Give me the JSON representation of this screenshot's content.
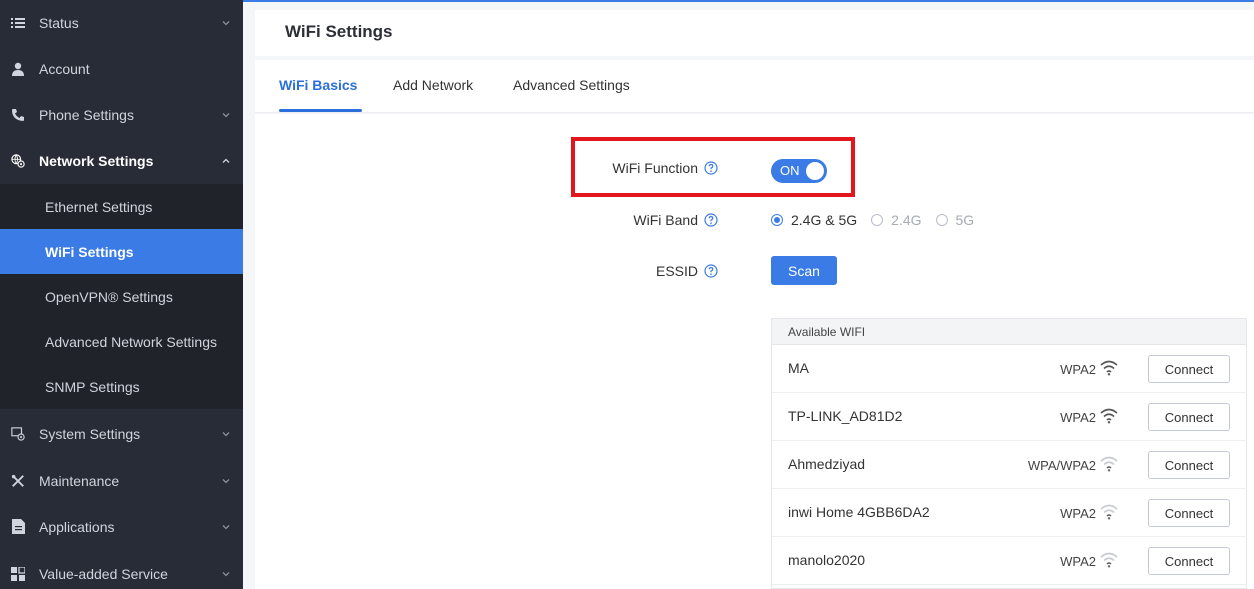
{
  "sidebar": {
    "items": [
      {
        "label": "Status",
        "icon": "list-icon"
      },
      {
        "label": "Account",
        "icon": "user-icon"
      },
      {
        "label": "Phone Settings",
        "icon": "phone-icon"
      },
      {
        "label": "Network Settings",
        "icon": "network-gear-icon"
      },
      {
        "label": "System Settings",
        "icon": "system-gear-icon"
      },
      {
        "label": "Maintenance",
        "icon": "tools-icon"
      },
      {
        "label": "Applications",
        "icon": "document-icon"
      },
      {
        "label": "Value-added Service",
        "icon": "grid-icon"
      }
    ],
    "network_subitems": [
      {
        "label": "Ethernet Settings"
      },
      {
        "label": "WiFi Settings"
      },
      {
        "label": "OpenVPN® Settings"
      },
      {
        "label": "Advanced Network Settings"
      },
      {
        "label": "SNMP Settings"
      }
    ]
  },
  "header": {
    "title": "WiFi Settings"
  },
  "tabs": [
    {
      "label": "WiFi Basics"
    },
    {
      "label": "Add Network"
    },
    {
      "label": "Advanced Settings"
    }
  ],
  "form": {
    "wifi_function_label": "WiFi Function",
    "wifi_function_value": "ON",
    "wifi_band_label": "WiFi Band",
    "band_options": [
      "2.4G & 5G",
      "2.4G",
      "5G"
    ],
    "band_selected": "2.4G & 5G",
    "essid_label": "ESSID",
    "scan_label": "Scan"
  },
  "wifi_list": {
    "header": "Available WIFI",
    "connect_label": "Connect",
    "networks": [
      {
        "ssid": "MA",
        "security": "WPA2",
        "signal": "strong"
      },
      {
        "ssid": "TP-LINK_AD81D2",
        "security": "WPA2",
        "signal": "strong"
      },
      {
        "ssid": "Ahmedziyad",
        "security": "WPA/WPA2",
        "signal": "weak"
      },
      {
        "ssid": "inwi Home 4GBB6DA2",
        "security": "WPA2",
        "signal": "weak"
      },
      {
        "ssid": "manolo2020",
        "security": "WPA2",
        "signal": "weak"
      }
    ]
  },
  "colors": {
    "sidebar_bg": "#282c36",
    "accent": "#3a7be6",
    "highlight": "#e3161e"
  }
}
